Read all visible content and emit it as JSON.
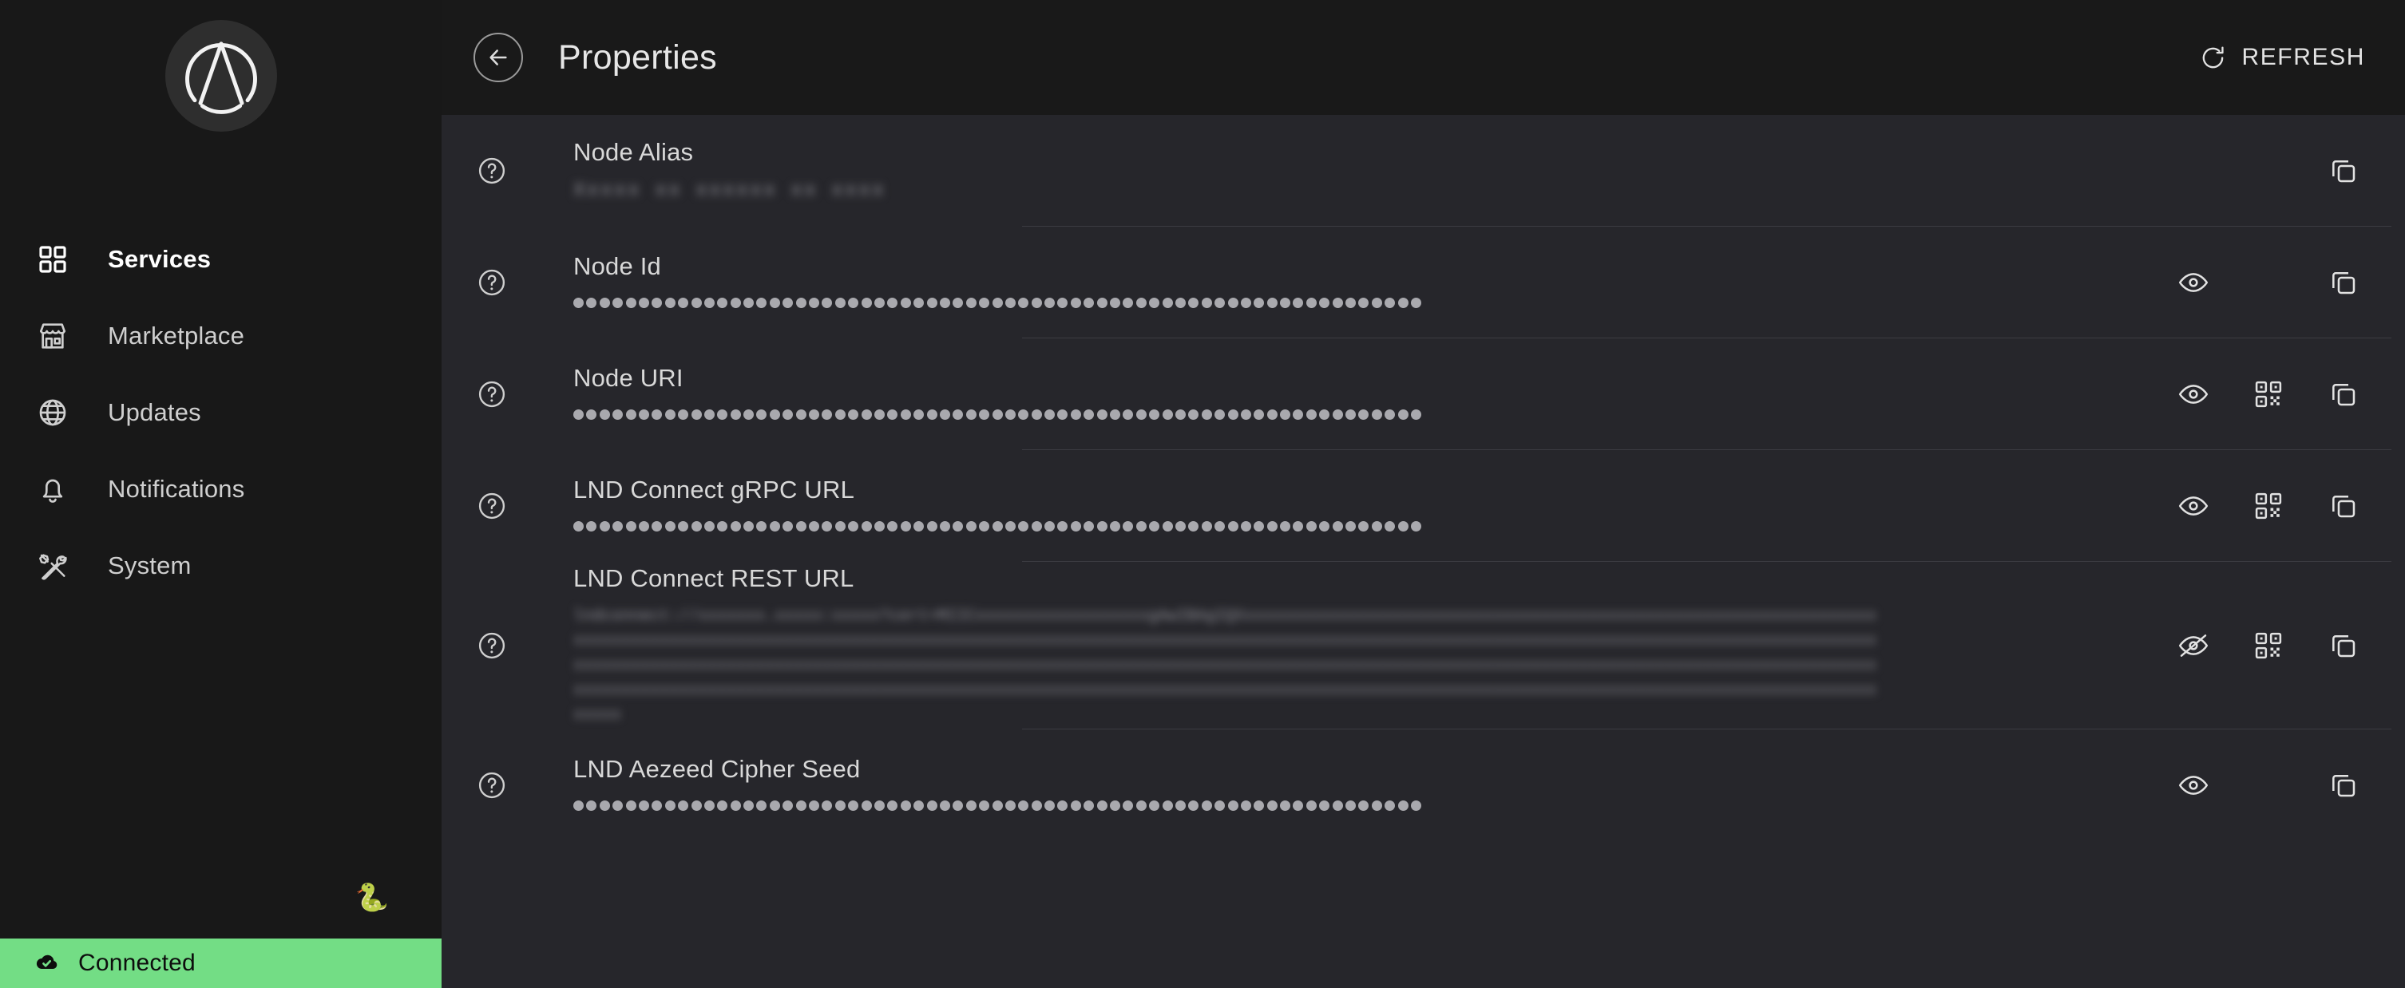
{
  "sidebar": {
    "logo_name": "umbrel-logo",
    "items": [
      {
        "label": "Services",
        "icon": "grid-icon",
        "active": true
      },
      {
        "label": "Marketplace",
        "icon": "storefront-icon",
        "active": false
      },
      {
        "label": "Updates",
        "icon": "globe-icon",
        "active": false
      },
      {
        "label": "Notifications",
        "icon": "bell-icon",
        "active": false
      },
      {
        "label": "System",
        "icon": "tools-icon",
        "active": false
      }
    ],
    "decoration_emoji": "🐍",
    "status": {
      "label": "Connected",
      "icon": "cloud-check-icon",
      "color": "#73dd85"
    }
  },
  "header": {
    "back_icon": "arrow-left-icon",
    "title": "Properties",
    "refresh_label": "REFRESH",
    "refresh_icon": "refresh-icon"
  },
  "properties": [
    {
      "label": "Node Alias",
      "value_type": "redacted",
      "redacted_text": "Xxxxx xx xxxxxx xx xxxx",
      "actions": [
        "copy-icon"
      ]
    },
    {
      "label": "Node Id",
      "value_type": "masked",
      "masked_dots": 65,
      "actions": [
        "eye-icon",
        "copy-icon"
      ]
    },
    {
      "label": "Node URI",
      "value_type": "masked",
      "masked_dots": 65,
      "actions": [
        "eye-icon",
        "qr-icon",
        "copy-icon"
      ]
    },
    {
      "label": "LND Connect gRPC URL",
      "value_type": "masked",
      "masked_dots": 65,
      "actions": [
        "eye-icon",
        "qr-icon",
        "copy-icon"
      ]
    },
    {
      "label": "LND Connect REST URL",
      "value_type": "redacted",
      "redacted_text": "lndconnect://xxxxxxx.xxxxx:xxxxx?cert=MIICxxxxxxxxxxxxxxxxxxgAwIBAgIQXxxxxxxxxxxxxxxxxxxxxxxxxxxxxxxxxxxxxxxxxxxxxxxxxxxxxxxxxxxxxxxxxxxxxxxxxxxxxxxxxxxxxxxxxxxxxxxxxxxxxxxxxxxxxxxxxxxxxxxxxxxxxxxxxxxxxxxxxxxxxxxxxxxxxxxxxxxxxxxxxxxxxxxxxxxxxxxxxxxxxxxxxxxxxxxxxxxxxxxxxxxxxxxxxxxxxxxxxxxxxxxxxxxxxxxxxxxxxxxxxxxxxxxxxxxxxxxxxxxxxxxxxxxxxxxxxxxxxxxxxxxxxxxxxxxxxxxxxxxxxxxxxxxxxxxxxxxxxxxxxxxxxxxxxxxxxxxxxxxxxxxxxxxxxxxxxxxxxxxxxxxxxxxxxxxxxxxxxxxxxxxxxxxxxxxxxxxxxxxxxxxxxxxxxxxxxxxxxxxxxxxxxxxxxxxxxxxxxxxxxxxxxxxxxxxxxxxxxxxxxxxxxxxxxxxxxxxxxxxx",
      "actions": [
        "eye-off-icon",
        "qr-icon",
        "copy-icon"
      ]
    },
    {
      "label": "LND Aezeed Cipher Seed",
      "value_type": "masked",
      "masked_dots": 65,
      "actions": [
        "eye-icon",
        "copy-icon"
      ]
    }
  ]
}
